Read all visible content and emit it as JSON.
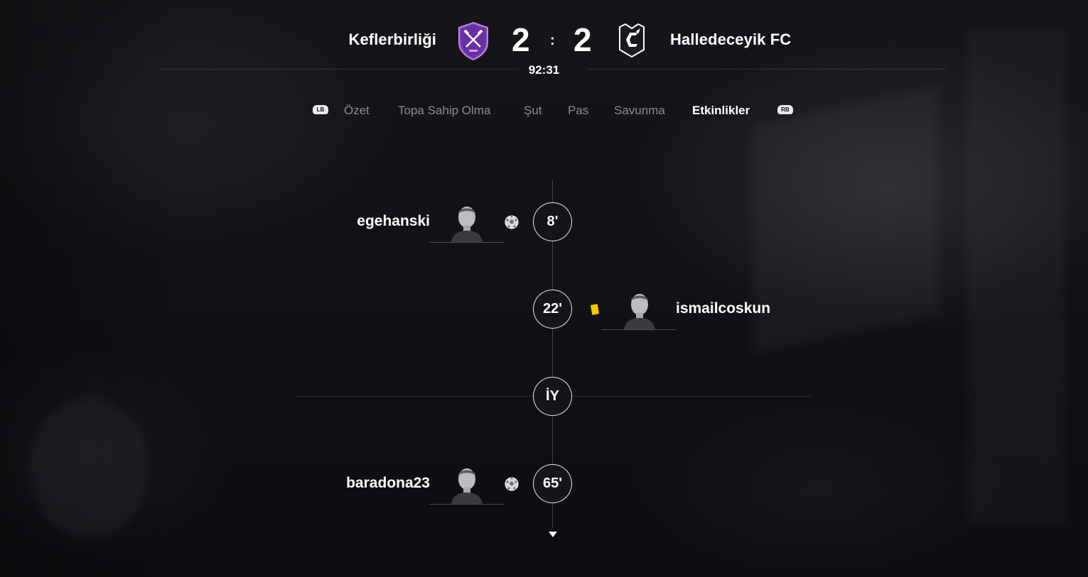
{
  "match": {
    "home_team": "Keflerbirliği",
    "away_team": "Halledeceyik FC",
    "home_score": "2",
    "away_score": "2",
    "separator": ":",
    "clock": "92:31",
    "colors": {
      "home_crest": "#7a3fb5",
      "away_crest": "#ffffff"
    }
  },
  "tabs": {
    "left_bumper": "LB",
    "right_bumper": "RB",
    "items": [
      "Özet",
      "Topa Sahip Olma",
      "Şut",
      "Pas",
      "Savunma",
      "Etkinlikler"
    ],
    "active": "Etkinlikler"
  },
  "events": [
    {
      "minute": "8'",
      "player": "egehanski",
      "side": "home",
      "type": "goal",
      "icon": "soccer-ball-icon"
    },
    {
      "minute": "22'",
      "player": "ismailcoskun",
      "side": "away",
      "type": "yellow-card",
      "icon": "yellow-card-icon",
      "color": "#f4c400"
    },
    {
      "minute": "İY",
      "type": "half-time"
    },
    {
      "minute": "65'",
      "player": "baradona23",
      "side": "home",
      "type": "goal",
      "icon": "soccer-ball-icon"
    }
  ],
  "scroll": {
    "icon": "chevron-down-icon"
  }
}
